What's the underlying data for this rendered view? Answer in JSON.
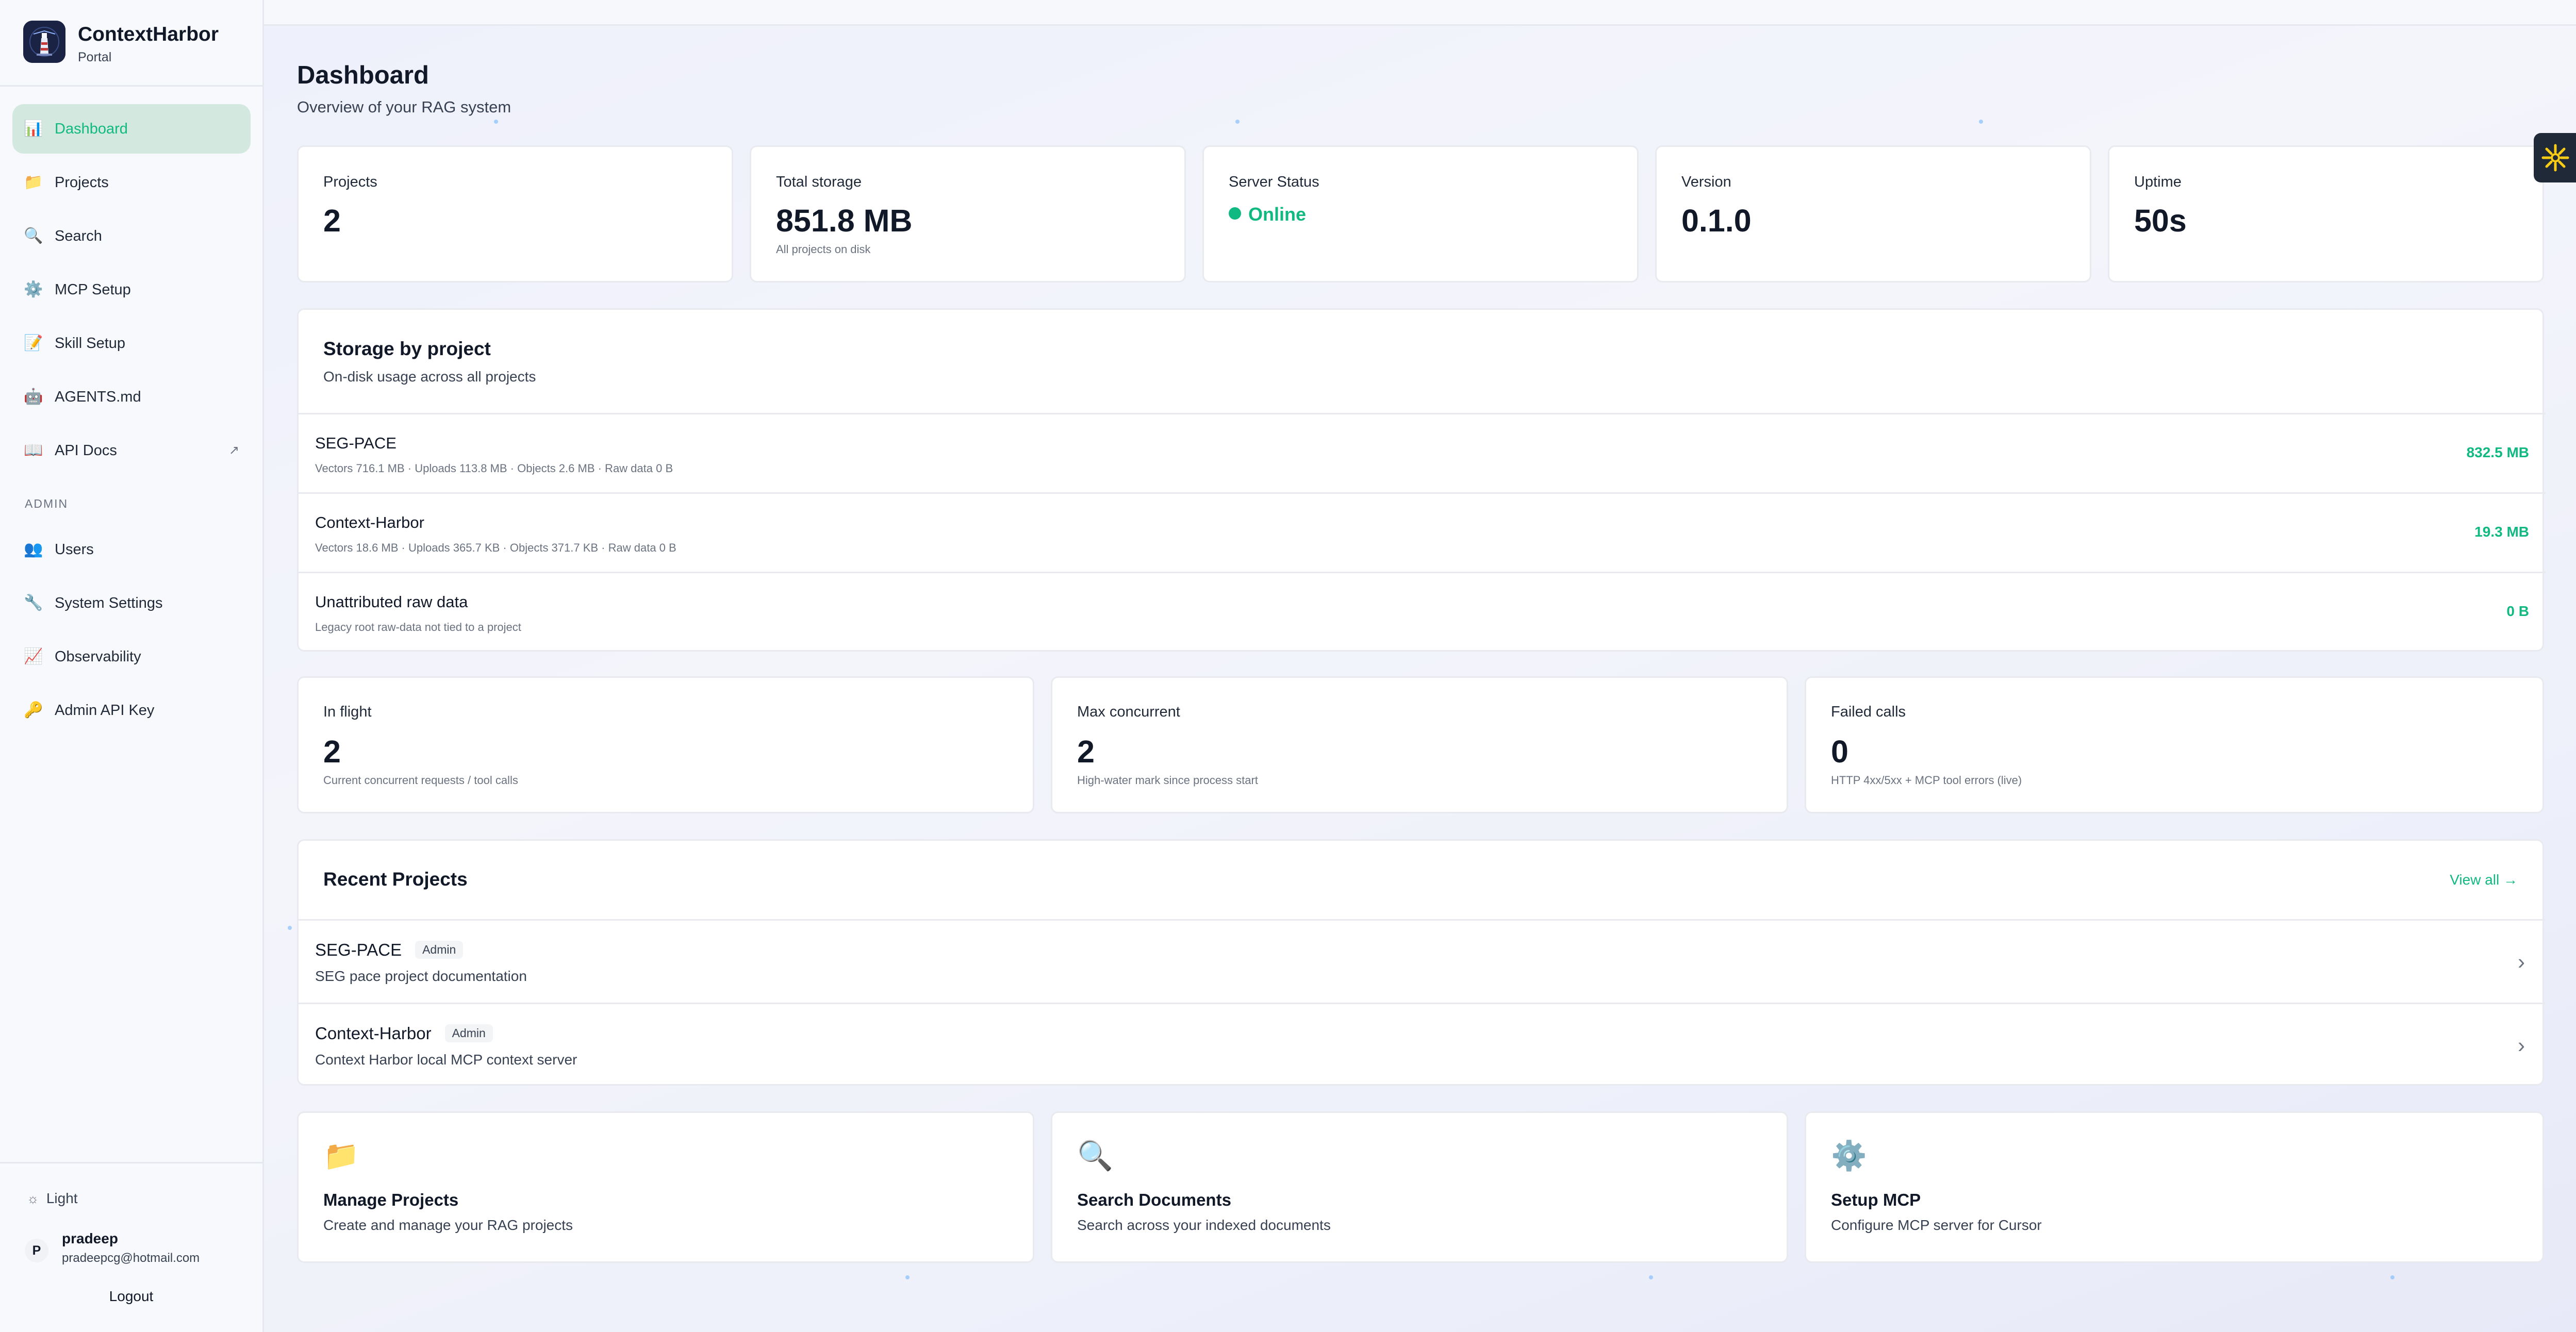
{
  "brand": {
    "title": "ContextHarbor",
    "subtitle": "Portal"
  },
  "sidebar": {
    "items": [
      {
        "label": "Dashboard",
        "icon": "bar-chart-icon",
        "glyph": "📊",
        "active": true
      },
      {
        "label": "Projects",
        "icon": "folder-icon",
        "glyph": "📁"
      },
      {
        "label": "Search",
        "icon": "search-icon",
        "glyph": "🔍"
      },
      {
        "label": "MCP Setup",
        "icon": "gear-icon",
        "glyph": "⚙️"
      },
      {
        "label": "Skill Setup",
        "icon": "memo-icon",
        "glyph": "📝"
      },
      {
        "label": "AGENTS.md",
        "icon": "robot-icon",
        "glyph": "🤖"
      },
      {
        "label": "API Docs",
        "icon": "book-icon",
        "glyph": "📖",
        "external": "↗"
      }
    ],
    "admin_label": "ADMIN",
    "admin_items": [
      {
        "label": "Users",
        "icon": "users-icon",
        "glyph": "👥"
      },
      {
        "label": "System Settings",
        "icon": "wrench-icon",
        "glyph": "🔧"
      },
      {
        "label": "Observability",
        "icon": "chart-up-icon",
        "glyph": "📈"
      },
      {
        "label": "Admin API Key",
        "icon": "key-icon",
        "glyph": "🔑"
      }
    ],
    "theme_label": "Light",
    "user": {
      "initial": "P",
      "name": "pradeep",
      "email": "pradeepcg@hotmail.com"
    },
    "logout_label": "Logout"
  },
  "page": {
    "title": "Dashboard",
    "subtitle": "Overview of your RAG system"
  },
  "stats": [
    {
      "label": "Projects",
      "value": "2"
    },
    {
      "label": "Total storage",
      "value": "851.8 MB",
      "note": "All projects on disk"
    },
    {
      "label": "Server Status",
      "value": "Online"
    },
    {
      "label": "Version",
      "value": "0.1.0"
    },
    {
      "label": "Uptime",
      "value": "50s"
    }
  ],
  "storage": {
    "title": "Storage by project",
    "subtitle": "On-disk usage across all projects",
    "rows": [
      {
        "name": "SEG-PACE",
        "detail": "Vectors 716.1 MB · Uploads 113.8 MB · Objects 2.6 MB · Raw data 0 B",
        "size": "832.5 MB"
      },
      {
        "name": "Context-Harbor",
        "detail": "Vectors 18.6 MB · Uploads 365.7 KB · Objects 371.7 KB · Raw data 0 B",
        "size": "19.3 MB"
      },
      {
        "name": "Unattributed raw data",
        "detail": "Legacy root raw-data not tied to a project",
        "size": "0 B"
      }
    ]
  },
  "metrics": [
    {
      "label": "In flight",
      "value": "2",
      "note": "Current concurrent requests / tool calls"
    },
    {
      "label": "Max concurrent",
      "value": "2",
      "note": "High-water mark since process start"
    },
    {
      "label": "Failed calls",
      "value": "0",
      "note": "HTTP 4xx/5xx + MCP tool errors (live)"
    }
  ],
  "recent": {
    "title": "Recent Projects",
    "view_all": "View all →",
    "projects": [
      {
        "name": "SEG-PACE",
        "badge": "Admin",
        "desc": "SEG pace project documentation"
      },
      {
        "name": "Context-Harbor",
        "badge": "Admin",
        "desc": "Context Harbor local MCP context server"
      }
    ]
  },
  "actions": [
    {
      "icon": "folder-icon",
      "glyph": "📁",
      "title": "Manage Projects",
      "desc": "Create and manage your RAG projects"
    },
    {
      "icon": "magnifier-icon",
      "glyph": "🔍",
      "title": "Search Documents",
      "desc": "Search across your indexed documents"
    },
    {
      "icon": "gear-icon",
      "glyph": "⚙️",
      "title": "Setup MCP",
      "desc": "Configure MCP server for Cursor"
    }
  ],
  "colors": {
    "accent": "#10b981",
    "active_bg": "#d3e9df",
    "brand_bg": "#1a2343"
  }
}
